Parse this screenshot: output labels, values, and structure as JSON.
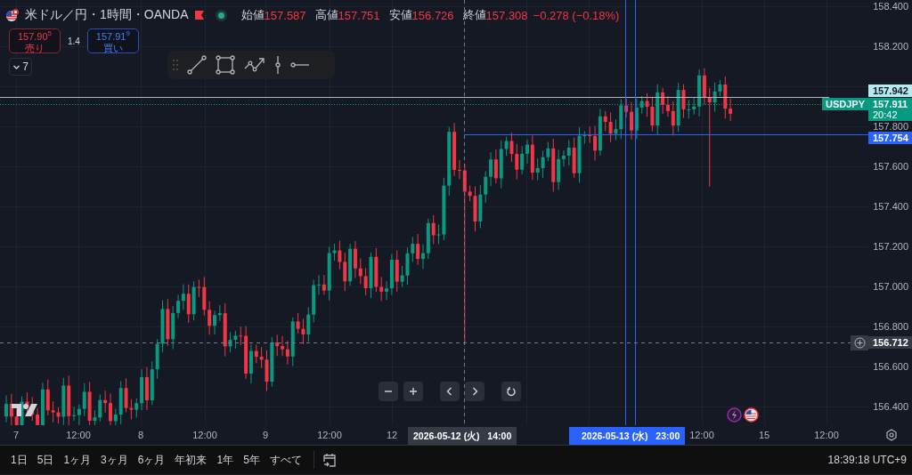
{
  "symbol": {
    "title": "米ドル／円・1時間・OANDA",
    "market_open": true
  },
  "ohlc": [
    {
      "label": "始値",
      "value": "157.587"
    },
    {
      "label": "高値",
      "value": "157.751"
    },
    {
      "label": "安値",
      "value": "156.726"
    },
    {
      "label": "終値",
      "value": "157.308"
    }
  ],
  "change": "−0.278 (−0.18%)",
  "trade": {
    "sell": {
      "price": "157.90$^{5}$",
      "label": "売り"
    },
    "spread": "1.4",
    "buy": {
      "price": "157.91$^{9}$",
      "label": "買い"
    }
  },
  "indicators": {
    "count": "7"
  },
  "price_axis": {
    "ticks": [
      "158.400",
      "158.200",
      "157.800",
      "157.600",
      "157.400",
      "157.200",
      "157.000",
      "156.800",
      "156.600",
      "156.400"
    ],
    "badges": [
      {
        "kind": "high",
        "value": "157.942"
      },
      {
        "kind": "last",
        "value": "157.911",
        "countdown": "20:42",
        "symbol": "USDJPY"
      },
      {
        "kind": "line",
        "value": "157.754"
      },
      {
        "kind": "crosshair",
        "value": "156.712"
      }
    ]
  },
  "time_axis": {
    "ticks": [
      "7",
      "12:00",
      "8",
      "12:00",
      "9",
      "12:00",
      "12",
      "12:00",
      "15",
      "12:00"
    ],
    "crosshair_time": "2026-05-12 (火)   14:00",
    "cursor_time": "2026-05-13 (水)   23:00"
  },
  "ranges": [
    {
      "label": "1日",
      "selected": false
    },
    {
      "label": "5日",
      "selected": false
    },
    {
      "label": "1ヶ月",
      "selected": false
    },
    {
      "label": "3ヶ月",
      "selected": false
    },
    {
      "label": "6ヶ月",
      "selected": false
    },
    {
      "label": "年初来",
      "selected": false
    },
    {
      "label": "1年",
      "selected": false
    },
    {
      "label": "5年",
      "selected": false
    },
    {
      "label": "すべて",
      "selected": false
    }
  ],
  "clock": "18:39:18 UTC+9"
}
